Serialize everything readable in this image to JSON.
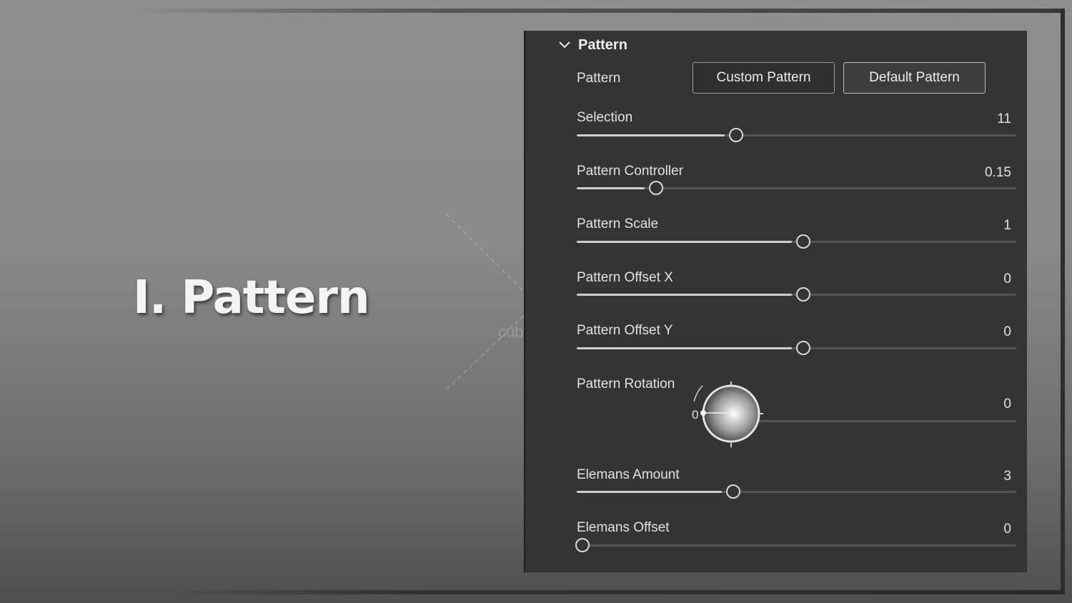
{
  "headline": "I. Pattern",
  "watermark": {
    "text": "cubebrush"
  },
  "panel": {
    "section_title": "Pattern",
    "pattern_row": {
      "label": "Pattern",
      "buttons": [
        {
          "label": "Custom Pattern",
          "active": false
        },
        {
          "label": "Default Pattern",
          "active": true
        }
      ]
    },
    "sliders": [
      {
        "key": "selection",
        "label": "Selection",
        "value": "11",
        "fraction": 0.35
      },
      {
        "key": "pattern-controller",
        "label": "Pattern Controller",
        "value": "0.15",
        "fraction": 0.168
      },
      {
        "key": "pattern-scale",
        "label": "Pattern Scale",
        "value": "1",
        "fraction": 0.502
      },
      {
        "key": "pattern-offset-x",
        "label": "Pattern Offset X",
        "value": "0",
        "fraction": 0.502
      },
      {
        "key": "pattern-offset-y",
        "label": "Pattern Offset Y",
        "value": "0",
        "fraction": 0.502
      },
      {
        "key": "pattern-rotation",
        "label": "Pattern Rotation",
        "value": "0",
        "fraction": 0.0,
        "has_dial": true,
        "dial_value": "0"
      },
      {
        "key": "elemans-amount",
        "label": "Elemans Amount",
        "value": "3",
        "fraction": 0.343
      },
      {
        "key": "elemans-offset",
        "label": "Elemans Offset",
        "value": "0",
        "fraction": 0.0
      }
    ]
  },
  "colors": {
    "panel_bg": "#343434",
    "slider_fill": "#cfcfcf",
    "slider_track": "#555555",
    "text": "#e2e2e2"
  }
}
